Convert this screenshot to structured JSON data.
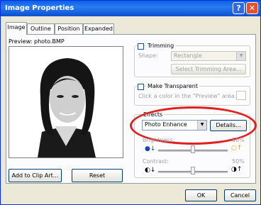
{
  "window": {
    "title": "Image Properties",
    "help_label": "?",
    "close_label": "✕"
  },
  "tabs": [
    {
      "label": "Image"
    },
    {
      "label": "Outline"
    },
    {
      "label": "Position"
    },
    {
      "label": "Expanded"
    }
  ],
  "preview": {
    "label": "Preview:",
    "filename": "photo.BMP"
  },
  "buttons": {
    "add_clip_art": "Add to Clip Art...",
    "reset": "Reset",
    "ok": "OK",
    "cancel": "Cancel"
  },
  "trimming": {
    "label": "Trimming",
    "shape_label": "Shape:",
    "shape_value": "Rectangle",
    "select_area": "Select Trimming Area..."
  },
  "transparent": {
    "label": "Make Transparent",
    "hint": "Click a color in the \"Preview\" area."
  },
  "effects": {
    "label": "Effects",
    "value": "Photo Enhance",
    "details": "Details..."
  },
  "brightness": {
    "label": "Brightness:",
    "value": "50%"
  },
  "contrast": {
    "label": "Contrast:",
    "value": "50%"
  }
}
